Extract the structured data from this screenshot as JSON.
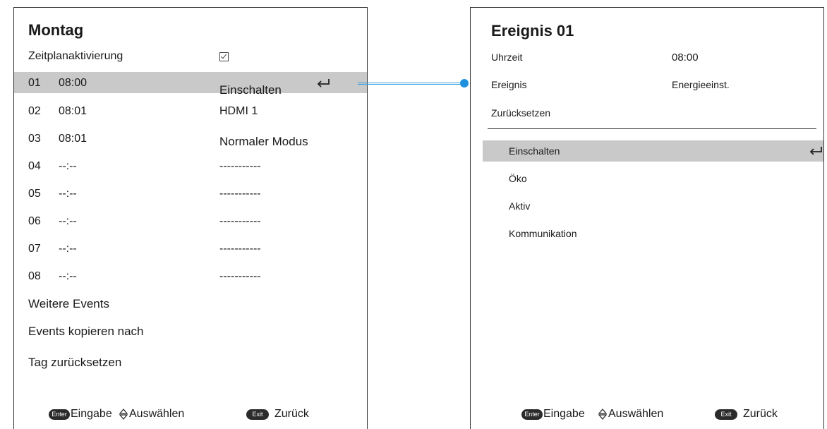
{
  "left": {
    "title": "Montag",
    "activation_label": "Zeitplanaktivierung",
    "events": [
      {
        "num": "01",
        "time": "08:00",
        "value": "Einschalten"
      },
      {
        "num": "02",
        "time": "08:01",
        "value": "HDMI 1"
      },
      {
        "num": "03",
        "time": "08:01",
        "value": "Normaler Modus"
      },
      {
        "num": "04",
        "time": "--:--",
        "value": "-----------"
      },
      {
        "num": "05",
        "time": "--:--",
        "value": "-----------"
      },
      {
        "num": "06",
        "time": "--:--",
        "value": "-----------"
      },
      {
        "num": "07",
        "time": "--:--",
        "value": "-----------"
      },
      {
        "num": "08",
        "time": "--:--",
        "value": "-----------"
      }
    ],
    "more_events": "Weitere Events",
    "copy_events": "Events kopieren nach",
    "reset_day": "Tag zurücksetzen",
    "footer": {
      "enter_badge": "Enter",
      "enter_label": "Eingabe",
      "select_label": "Auswählen",
      "exit_badge": "Exit",
      "back_label": "Zurück"
    }
  },
  "right": {
    "title": "Ereignis 01",
    "time_label": "Uhrzeit",
    "time_value": "08:00",
    "event_label": "Ereignis",
    "event_value": "Energieeinst.",
    "reset_label": "Zurücksetzen",
    "options": [
      "Einschalten",
      "Öko",
      "Aktiv",
      "Kommunikation"
    ],
    "footer": {
      "enter_badge": "Enter",
      "enter_label": "Eingabe",
      "select_label": "Auswählen",
      "exit_badge": "Exit",
      "back_label": "Zurück"
    }
  },
  "icons": {
    "enter": "enter-arrow-icon",
    "checkbox": "checkbox-checked-icon",
    "updown": "up-down-arrow-icon",
    "connector_accent": "#1e90e0"
  }
}
